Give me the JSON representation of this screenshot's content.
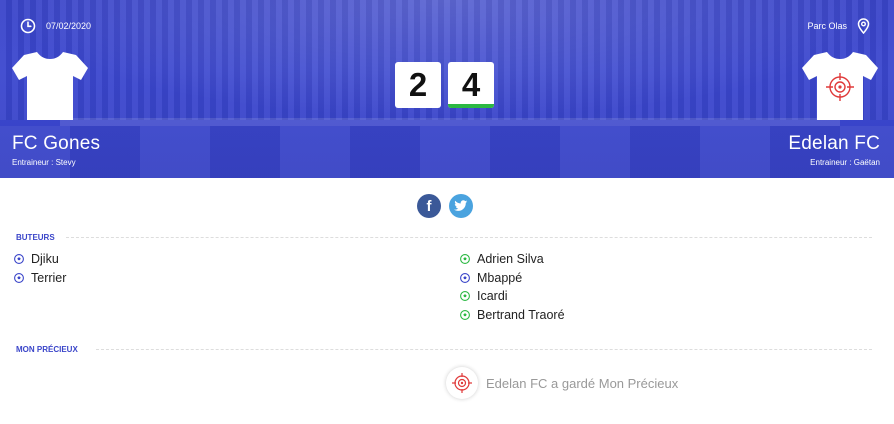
{
  "match": {
    "date": "07/02/2020",
    "venue": "Parc Olas",
    "home": {
      "name": "FC Gones",
      "coach": "Entraineur : Stevy",
      "score": "2"
    },
    "away": {
      "name": "Edelan FC",
      "coach": "Entraineur : Gaëtan",
      "score": "4"
    }
  },
  "share": {
    "facebook_glyph": "f",
    "twitter_glyph": "t"
  },
  "scorers": {
    "title": "BUTEURS",
    "home": [
      "Djiku",
      "Terrier"
    ],
    "away": [
      "Adrien Silva",
      "Mbappé",
      "Icardi",
      "Bertrand Traoré"
    ],
    "home_ball_colors": [
      "#3a45c9",
      "#3a45c9"
    ],
    "away_ball_colors": [
      "#2bb842",
      "#3a45c9",
      "#2bb842",
      "#2bb842"
    ]
  },
  "precieux": {
    "title": "MON PRÉCIEUX",
    "text": "Edelan FC a gardé Mon Précieux"
  },
  "colors": {
    "primary": "#3a45c9",
    "green": "#2bb842",
    "target_red": "#e03a3a"
  }
}
